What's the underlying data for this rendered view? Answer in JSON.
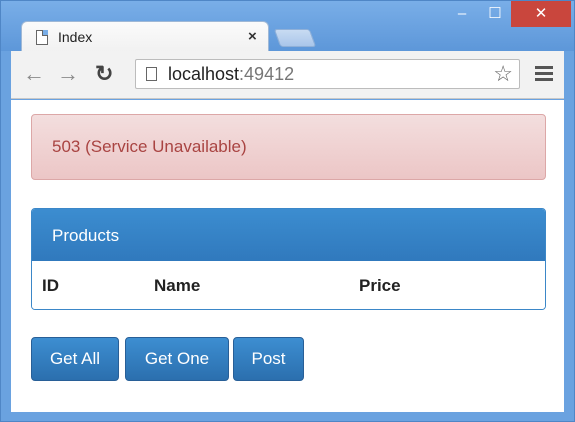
{
  "window": {
    "minimize_glyph": "‒",
    "maximize_glyph": "☐",
    "close_glyph": "✕"
  },
  "tab": {
    "title": "Index",
    "close_glyph": "×"
  },
  "toolbar": {
    "back_glyph": "←",
    "forward_glyph": "→",
    "reload_glyph": "↻",
    "url_host": "localhost",
    "url_port": ":49412",
    "star_glyph": "☆"
  },
  "alert": {
    "message": "503 (Service Unavailable)"
  },
  "panel": {
    "title": "Products",
    "columns": [
      "ID",
      "Name",
      "Price"
    ]
  },
  "buttons": {
    "get_all": "Get All",
    "get_one": "Get One",
    "post": "Post"
  },
  "colors": {
    "primary": "#337ab7",
    "danger_text": "#a94442",
    "window_frame": "#6aa2e0",
    "close_button": "#c9463d"
  }
}
